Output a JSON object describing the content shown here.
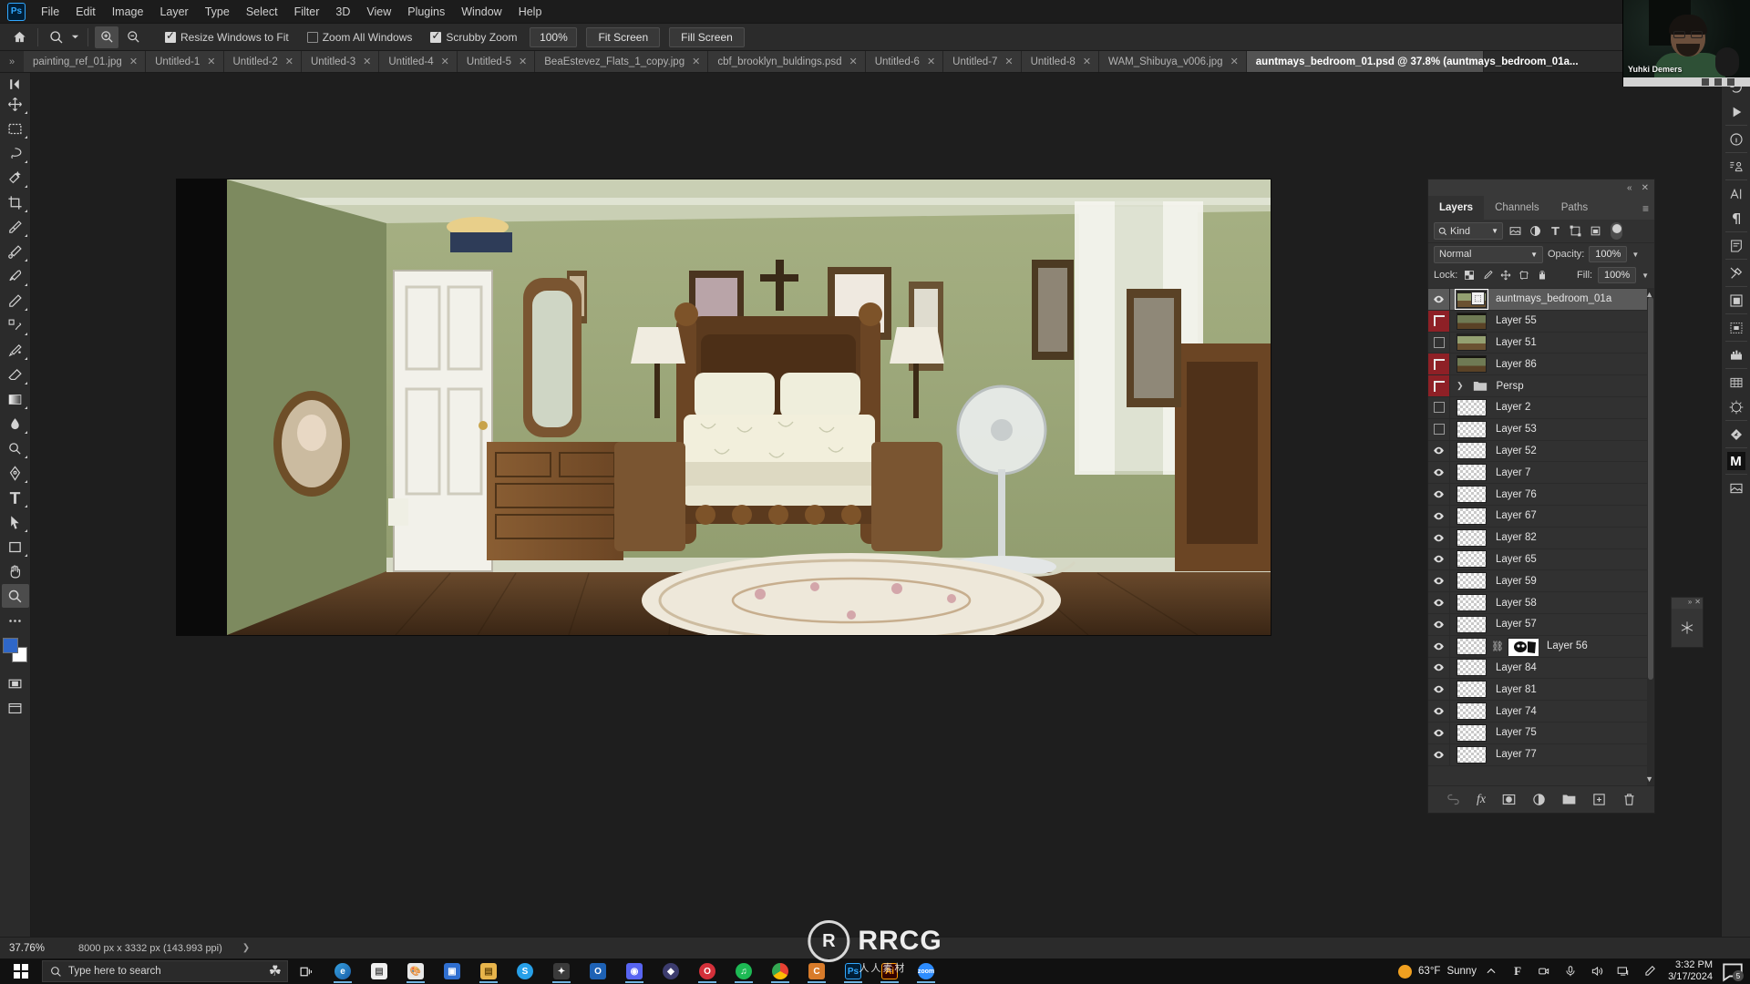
{
  "app": {
    "logo": "Ps",
    "title": "Adobe Photoshop"
  },
  "menu": {
    "items": [
      "File",
      "Edit",
      "Image",
      "Layer",
      "Type",
      "Select",
      "Filter",
      "3D",
      "View",
      "Plugins",
      "Window",
      "Help"
    ]
  },
  "options_bar": {
    "home_icon": "home-icon",
    "tool_icon": "zoom-tool-icon",
    "zoom_in_icon": "zoom-in-icon",
    "zoom_out_icon": "zoom-out-icon",
    "checkboxes": [
      {
        "label": "Resize Windows to Fit",
        "checked": true
      },
      {
        "label": "Zoom All Windows",
        "checked": false
      },
      {
        "label": "Scrubby Zoom",
        "checked": true
      }
    ],
    "zoom_value": "100%",
    "buttons": [
      "Fit Screen",
      "Fill Screen"
    ]
  },
  "tabs": {
    "overflow_icon": "chevron-right-double-icon",
    "items": [
      {
        "label": "painting_ref_01.jpg",
        "active": false
      },
      {
        "label": "Untitled-1",
        "active": false
      },
      {
        "label": "Untitled-2",
        "active": false
      },
      {
        "label": "Untitled-3",
        "active": false
      },
      {
        "label": "Untitled-4",
        "active": false
      },
      {
        "label": "Untitled-5",
        "active": false
      },
      {
        "label": "BeaEstevez_Flats_1_copy.jpg",
        "active": false
      },
      {
        "label": "cbf_brooklyn_buldings.psd",
        "active": false
      },
      {
        "label": "Untitled-6",
        "active": false
      },
      {
        "label": "Untitled-7",
        "active": false
      },
      {
        "label": "Untitled-8",
        "active": false
      },
      {
        "label": "WAM_Shibuya_v006.jpg",
        "active": false
      },
      {
        "label": "auntmays_bedroom_01.psd @ 37.8% (auntmays_bedroom_01a...",
        "active": true
      }
    ]
  },
  "toolbar": {
    "tools": [
      {
        "name": "move-tool",
        "selected": false
      },
      {
        "name": "rectangular-marquee-tool",
        "selected": false
      },
      {
        "name": "lasso-tool",
        "selected": false
      },
      {
        "name": "object-selection-tool",
        "selected": false
      },
      {
        "name": "crop-tool",
        "selected": false
      },
      {
        "name": "eyedropper-tool",
        "selected": false
      },
      {
        "name": "spot-healing-brush-tool",
        "selected": false
      },
      {
        "name": "brush-tool",
        "selected": false
      },
      {
        "name": "pencil-tool",
        "selected": false
      },
      {
        "name": "clone-stamp-tool",
        "selected": false
      },
      {
        "name": "history-brush-tool",
        "selected": false
      },
      {
        "name": "eraser-tool",
        "selected": false
      },
      {
        "name": "gradient-tool",
        "selected": false
      },
      {
        "name": "blur-tool",
        "selected": false
      },
      {
        "name": "dodge-tool",
        "selected": false
      },
      {
        "name": "pen-tool",
        "selected": false
      },
      {
        "name": "type-tool",
        "selected": false
      },
      {
        "name": "path-selection-tool",
        "selected": false
      },
      {
        "name": "shape-tool",
        "selected": false
      },
      {
        "name": "hand-tool",
        "selected": false
      },
      {
        "name": "zoom-tool",
        "selected": true
      },
      {
        "name": "more-tools",
        "selected": false
      }
    ],
    "foreground_color": "#2f67c8",
    "background_color": "#ffffff"
  },
  "layers_panel": {
    "tabs": [
      {
        "label": "Layers",
        "active": true
      },
      {
        "label": "Channels",
        "active": false
      },
      {
        "label": "Paths",
        "active": false
      }
    ],
    "collapse_icon": "collapse-icon",
    "close_icon": "close-icon",
    "menu_icon": "panel-menu-icon",
    "filter": {
      "kind_label": "Kind",
      "search_icon": "search-icon",
      "filter_icons": [
        "pixel-filter-icon",
        "adjustment-filter-icon",
        "type-filter-icon",
        "shape-filter-icon",
        "smart-object-filter-icon"
      ],
      "toggle_on": true
    },
    "blend_mode": "Normal",
    "opacity_label": "Opacity:",
    "opacity_value": "100%",
    "lock_label": "Lock:",
    "lock_icons": [
      "lock-transparent-pixels-icon",
      "lock-image-pixels-icon",
      "lock-position-icon",
      "lock-artboard-icon",
      "lock-all-icon"
    ],
    "fill_label": "Fill:",
    "fill_value": "100%",
    "layers": [
      {
        "name": "auntmays_bedroom_01a",
        "visible": true,
        "red": false,
        "thumb": "photo-light",
        "smart": true,
        "selected": true
      },
      {
        "name": "Layer 55",
        "visible": false,
        "red": true,
        "thumb": "photo"
      },
      {
        "name": "Layer 51",
        "visible": false,
        "red": false,
        "thumb": "photo-light"
      },
      {
        "name": "Layer 86",
        "visible": false,
        "red": true,
        "thumb": "photo"
      },
      {
        "name": "Persp",
        "visible": false,
        "red": true,
        "thumb": "folder",
        "group": true
      },
      {
        "name": "Layer 2",
        "visible": false,
        "red": false,
        "thumb": "empty"
      },
      {
        "name": "Layer 53",
        "visible": false,
        "red": false,
        "thumb": "empty"
      },
      {
        "name": "Layer 52",
        "visible": true,
        "red": false,
        "thumb": "empty"
      },
      {
        "name": "Layer 7",
        "visible": true,
        "red": false,
        "thumb": "empty"
      },
      {
        "name": "Layer 76",
        "visible": true,
        "red": false,
        "thumb": "empty"
      },
      {
        "name": "Layer 67",
        "visible": true,
        "red": false,
        "thumb": "empty"
      },
      {
        "name": "Layer 82",
        "visible": true,
        "red": false,
        "thumb": "empty"
      },
      {
        "name": "Layer 65",
        "visible": true,
        "red": false,
        "thumb": "empty"
      },
      {
        "name": "Layer 59",
        "visible": true,
        "red": false,
        "thumb": "empty"
      },
      {
        "name": "Layer 58",
        "visible": true,
        "red": false,
        "thumb": "empty"
      },
      {
        "name": "Layer 57",
        "visible": true,
        "red": false,
        "thumb": "empty"
      },
      {
        "name": "Layer 56",
        "visible": true,
        "red": false,
        "thumb": "empty",
        "mask": true
      },
      {
        "name": "Layer 84",
        "visible": true,
        "red": false,
        "thumb": "empty"
      },
      {
        "name": "Layer 81",
        "visible": true,
        "red": false,
        "thumb": "empty"
      },
      {
        "name": "Layer 74",
        "visible": true,
        "red": false,
        "thumb": "empty"
      },
      {
        "name": "Layer 75",
        "visible": true,
        "red": false,
        "thumb": "empty"
      },
      {
        "name": "Layer 77",
        "visible": true,
        "red": false,
        "thumb": "empty"
      }
    ],
    "footer_icons": [
      "link-layers-icon",
      "layer-style-fx-icon",
      "add-layer-mask-icon",
      "new-adjustment-layer-icon",
      "new-group-icon",
      "new-layer-icon",
      "delete-layer-icon"
    ]
  },
  "right_rail": {
    "icons": [
      "history-icon",
      "play-action-icon",
      "info-icon",
      "clone-source-icon",
      "character-icon",
      "paragraph-icon",
      "notes-icon",
      "tool-presets-icon",
      "layer-comps-icon",
      "adjustments-icon",
      "brush-settings-icon",
      "libraries-icon",
      "navigator-icon",
      "properties-icon",
      "measurement-icon",
      "asset-icon"
    ]
  },
  "status_bar": {
    "zoom": "37.76%",
    "doc_info": "8000 px x 3332 px (143.993 ppi)",
    "expand_icon": "chevron-right-icon"
  },
  "taskbar": {
    "start_icon": "windows-start-icon",
    "search_placeholder": "Type here to search",
    "search_icon": "search-icon",
    "decoration_icon": "shamrock-icon",
    "apps": [
      {
        "name": "task-view-icon",
        "label": "",
        "color": "#2b2b2b",
        "running": false
      },
      {
        "name": "edge-icon",
        "label": "e",
        "color": "#2a7fc9",
        "running": true
      },
      {
        "name": "file-explorer-white-icon",
        "label": "",
        "color": "#e9e9e9",
        "running": false
      },
      {
        "name": "paint-icon",
        "label": "",
        "color": "#d9d9d9",
        "running": true
      },
      {
        "name": "store-icon",
        "label": "",
        "color": "#2f6fd0",
        "running": false
      },
      {
        "name": "file-explorer-icon",
        "label": "",
        "color": "#e7b44b",
        "running": true
      },
      {
        "name": "skype-icon",
        "label": "S",
        "color": "#27a0e8",
        "running": false
      },
      {
        "name": "procreate-icon",
        "label": "",
        "color": "#3a3a3a",
        "running": true
      },
      {
        "name": "outlook-icon",
        "label": "",
        "color": "#1e62b5",
        "running": false
      },
      {
        "name": "discord-icon",
        "label": "",
        "color": "#5865f2",
        "running": true
      },
      {
        "name": "affinity-icon",
        "label": "",
        "color": "#3c3c6e",
        "running": false
      },
      {
        "name": "opera-icon",
        "label": "O",
        "color": "#d4303a",
        "running": true
      },
      {
        "name": "spotify-icon",
        "label": "",
        "color": "#1db954",
        "running": true
      },
      {
        "name": "chrome-icon",
        "label": "",
        "color": "#e8e8e8",
        "running": true
      },
      {
        "name": "clip-studio-icon",
        "label": "",
        "color": "#d87b2a",
        "running": true
      },
      {
        "name": "photoshop-icon",
        "label": "Ps",
        "color": "#001e36",
        "running": true
      },
      {
        "name": "illustrator-icon",
        "label": "Ai",
        "color": "#f0a020",
        "running": true
      },
      {
        "name": "zoom-app-icon",
        "label": "",
        "color": "#2d8cff",
        "running": true
      }
    ],
    "tray": {
      "temperature": "63°F",
      "weather": "Sunny",
      "chevron_icon": "chevron-up-icon",
      "icons": [
        "font-manager-icon",
        "webcam-icon",
        "microphone-icon",
        "volume-icon",
        "network-icon",
        "pen-icon"
      ],
      "time": "3:32 PM",
      "date": "3/17/2024",
      "notification_icon": "notification-icon",
      "notification_count": "5"
    }
  },
  "webcam": {
    "name": "Yuhki Demers"
  },
  "watermark": {
    "logo": "R",
    "text": "RRCG",
    "subtext": "人人素材"
  },
  "canvas": {
    "document_name": "auntmays_bedroom_01.psd",
    "scene_description": "Illustrated bedroom interior with green walls, wooden bed, dresser, mirror, lamps, fan and rug"
  }
}
